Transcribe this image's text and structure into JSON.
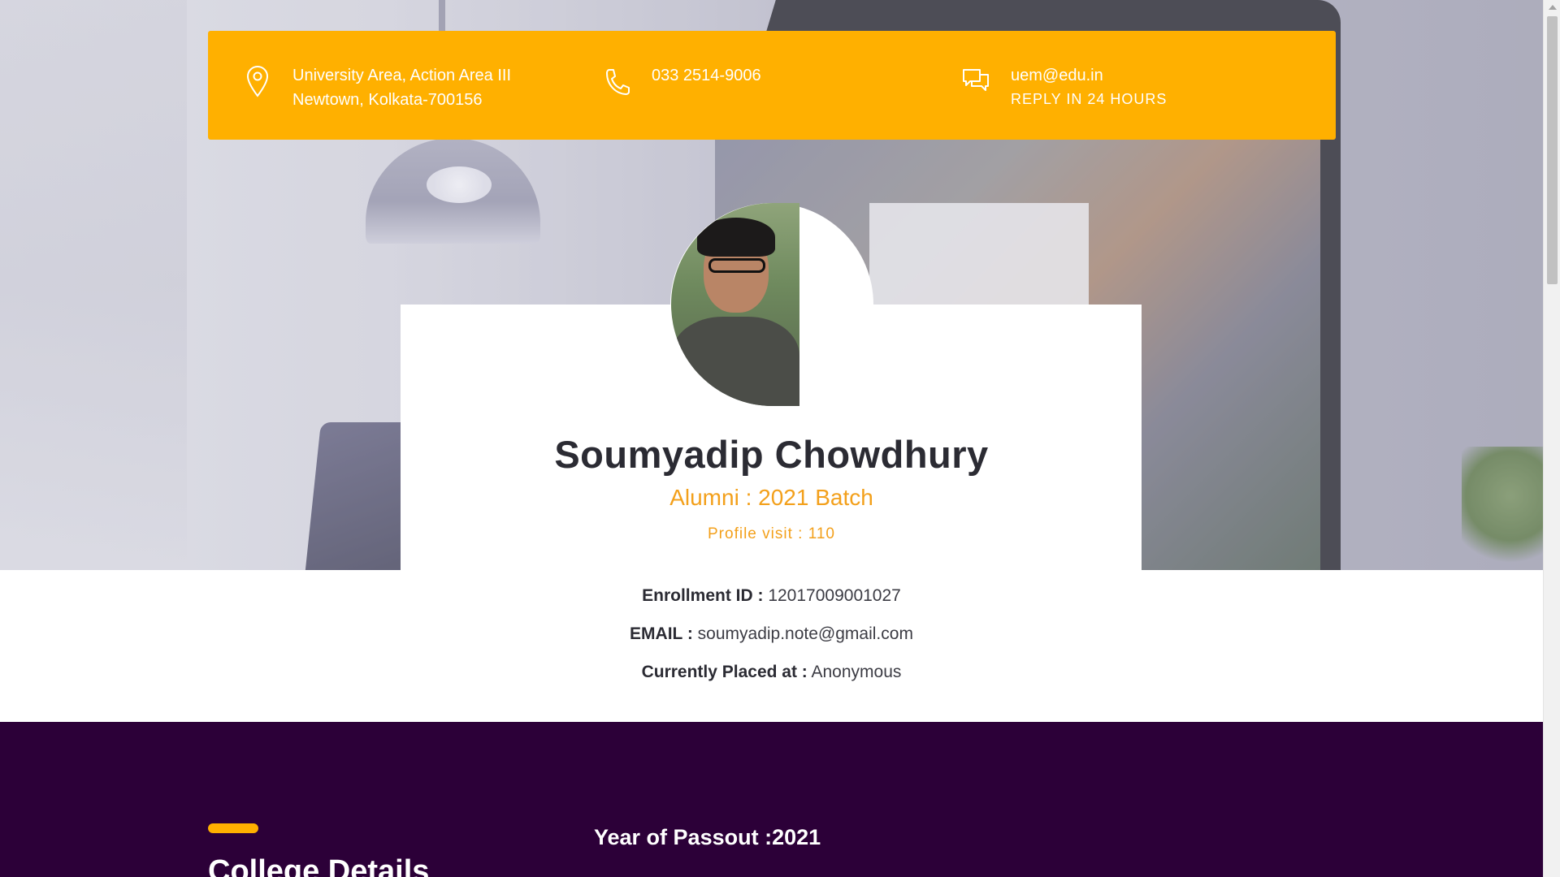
{
  "contact": {
    "address_line1": "University Area, Action Area III",
    "address_line2": "Newtown, Kolkata-700156",
    "phone": "033 2514-9006",
    "email": "uem@edu.in",
    "email_note": "REPLY IN 24 HOURS",
    "icons": [
      "location-pin-icon",
      "phone-icon",
      "chat-icon"
    ]
  },
  "profile": {
    "name": "Soumyadip Chowdhury",
    "batch": "Alumni : 2021 Batch",
    "visits": "Profile visit : 110"
  },
  "details": {
    "enrollment_label": "Enrollment ID :",
    "enrollment_value": "12017009001027",
    "email_label": "EMAIL :",
    "email_value": "soumyadip.note@gmail.com",
    "placed_label": "Currently Placed at :",
    "placed_value": "Anonymous"
  },
  "college": {
    "title": "College Details",
    "passout": "Year of Passout :2021"
  },
  "colors": {
    "accent": "#ffb000",
    "highlight_text": "#f3a01b",
    "section_bg": "#2c0038"
  }
}
